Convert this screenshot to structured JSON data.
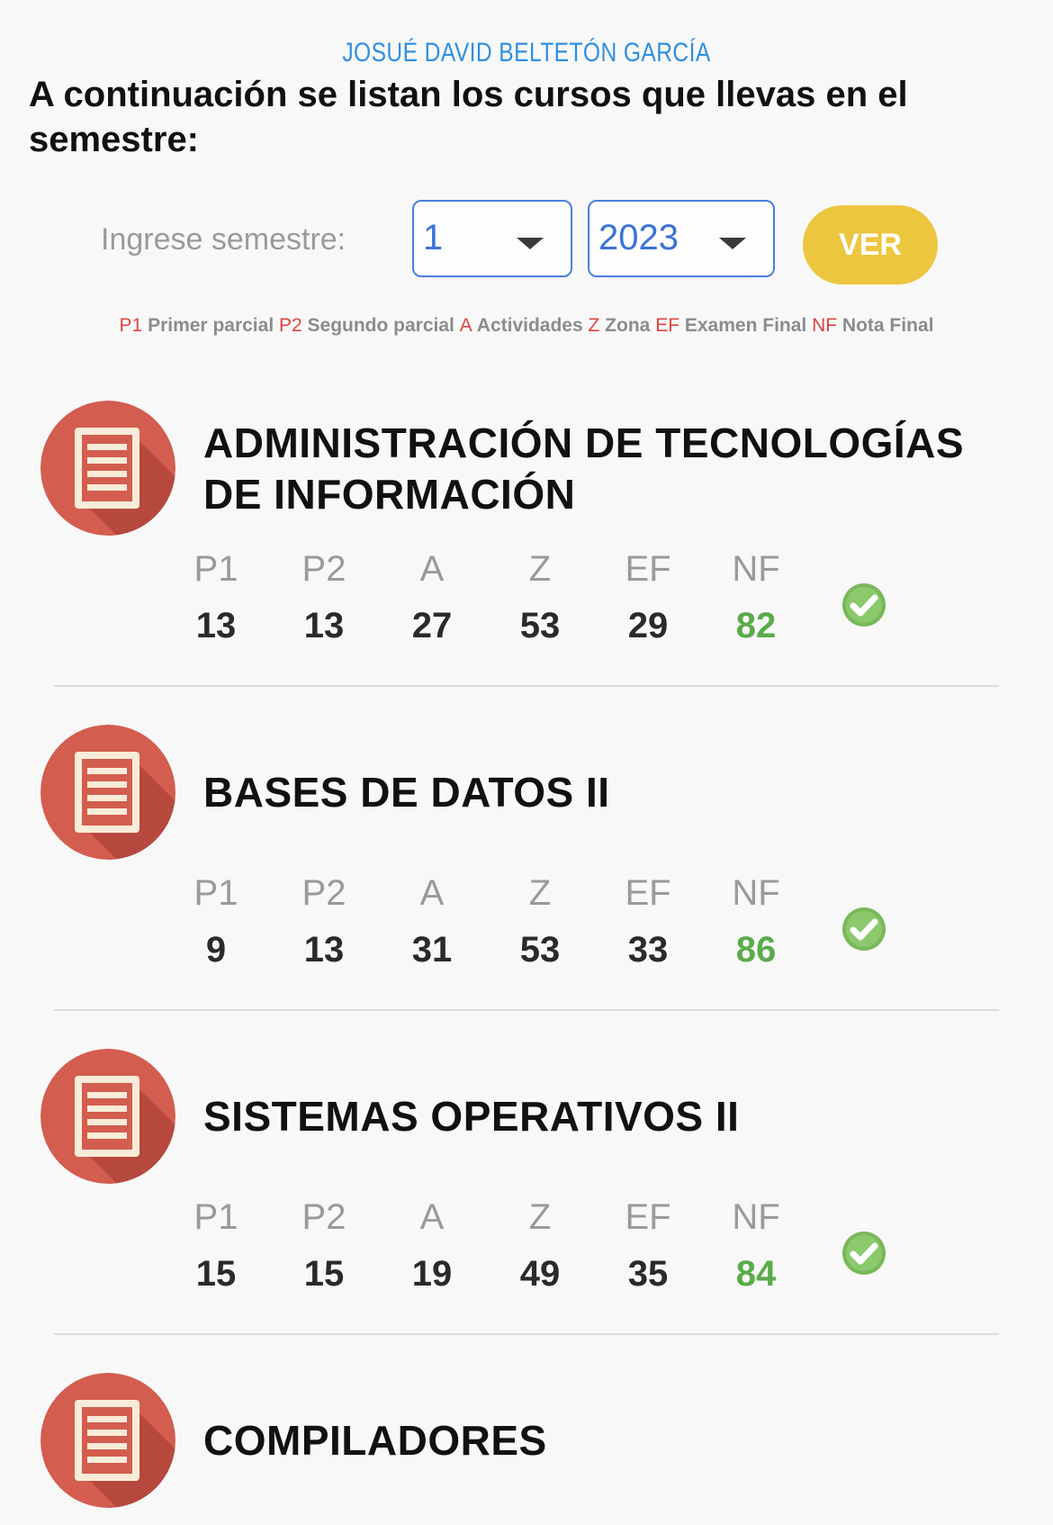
{
  "header": {
    "user_name": "JOSUÉ DAVID BELTETÓN GARCÍA",
    "intro": "A continuación se listan los cursos que llevas en el semestre:"
  },
  "filters": {
    "semester_label": "Ingrese semestre:",
    "semester_value": "1",
    "year_value": "2023",
    "submit_label": "VER"
  },
  "legend": [
    {
      "code": "P1",
      "text": "Primer parcial"
    },
    {
      "code": "P2",
      "text": "Segundo parcial"
    },
    {
      "code": "A",
      "text": "Actividades"
    },
    {
      "code": "Z",
      "text": "Zona"
    },
    {
      "code": "EF",
      "text": "Examen Final"
    },
    {
      "code": "NF",
      "text": "Nota Final"
    }
  ],
  "grade_labels": [
    "P1",
    "P2",
    "A",
    "Z",
    "EF",
    "NF"
  ],
  "courses": [
    {
      "title": "ADMINISTRACIÓN DE TECNOLOGÍAS DE INFORMACIÓN",
      "grades": [
        "13",
        "13",
        "27",
        "53",
        "29",
        "82"
      ],
      "icon": "document-icon",
      "status_icon": "check-icon"
    },
    {
      "title": "BASES DE DATOS II",
      "grades": [
        "9",
        "13",
        "31",
        "53",
        "33",
        "86"
      ],
      "icon": "document-icon",
      "status_icon": "check-icon"
    },
    {
      "title": "SISTEMAS OPERATIVOS II",
      "grades": [
        "15",
        "15",
        "19",
        "49",
        "35",
        "84"
      ],
      "icon": "document-icon",
      "status_icon": "check-icon"
    },
    {
      "title": "COMPILADORES",
      "grades": [],
      "icon": "document-icon",
      "status_icon": ""
    }
  ],
  "colors": {
    "accent_blue": "#2f8fe0",
    "button_yellow": "#ecc63f",
    "legend_code_red": "#e0443e",
    "nf_green": "#5aab4b",
    "icon_red": "#d35d4f"
  }
}
